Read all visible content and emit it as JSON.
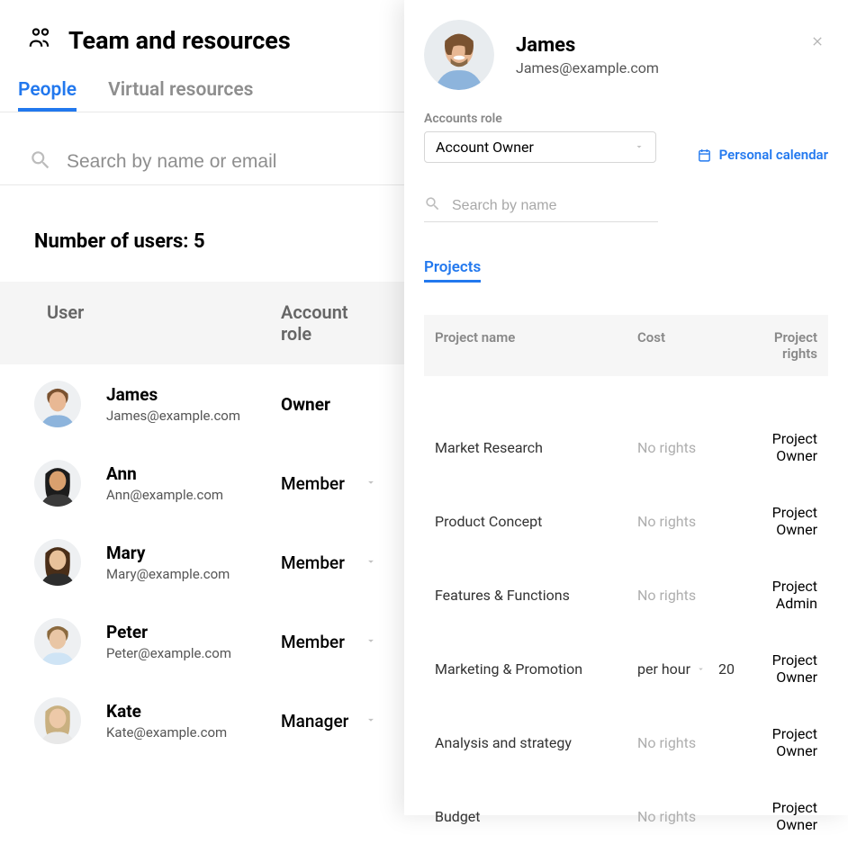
{
  "header": {
    "title": "Team and resources"
  },
  "tabs": {
    "active": "People",
    "inactive": "Virtual resources"
  },
  "search": {
    "placeholder": "Search by name or email"
  },
  "userCount": "Number of users: 5",
  "tableHeaders": {
    "user": "User",
    "role": "Account role"
  },
  "users": [
    {
      "name": "James",
      "email": "James@example.com",
      "role": "Owner",
      "owner": true,
      "hasCaret": false
    },
    {
      "name": "Ann",
      "email": "Ann@example.com",
      "role": "Member",
      "owner": false,
      "hasCaret": true
    },
    {
      "name": "Mary",
      "email": "Mary@example.com",
      "role": "Member",
      "owner": false,
      "hasCaret": true
    },
    {
      "name": "Peter",
      "email": "Peter@example.com",
      "role": "Member",
      "owner": false,
      "hasCaret": true
    },
    {
      "name": "Kate",
      "email": "Kate@example.com",
      "role": "Manager",
      "owner": false,
      "hasCaret": true
    }
  ],
  "drawer": {
    "name": "James",
    "email": "James@example.com",
    "roleLabel": "Accounts role",
    "roleValue": "Account Owner",
    "calendarLink": "Personal calendar",
    "searchPlaceholder": "Search by name",
    "projectsTab": "Projects",
    "projectHeaders": {
      "name": "Project name",
      "cost": "Cost",
      "rights": "Project rights"
    },
    "projects": [
      {
        "name": "Market Research",
        "cost": "No rights",
        "costActive": false,
        "costVal": "",
        "rights": "Project Owner"
      },
      {
        "name": "Product Concept",
        "cost": "No rights",
        "costActive": false,
        "costVal": "",
        "rights": "Project Owner"
      },
      {
        "name": "Features & Functions",
        "cost": "No rights",
        "costActive": false,
        "costVal": "",
        "rights": "Project Admin"
      },
      {
        "name": "Marketing & Promotion",
        "cost": "per hour",
        "costActive": true,
        "costVal": "20",
        "rights": "Project Owner"
      },
      {
        "name": "Analysis and strategy",
        "cost": "No rights",
        "costActive": false,
        "costVal": "",
        "rights": "Project Owner"
      },
      {
        "name": "Budget",
        "cost": "No rights",
        "costActive": false,
        "costVal": "",
        "rights": "Project Owner"
      }
    ]
  }
}
